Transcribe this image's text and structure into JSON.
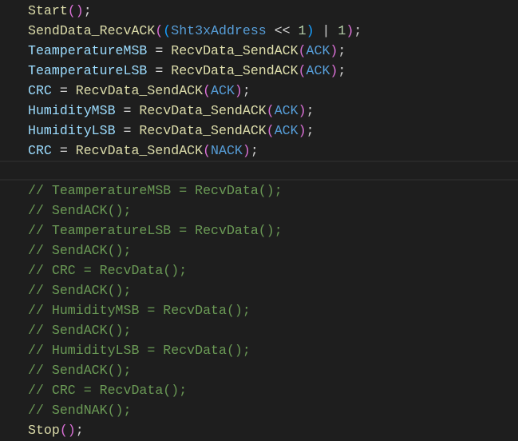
{
  "editor": {
    "current_line_index": 8,
    "colors": {
      "background": "#1e1e1e",
      "function": "#dcdcaa",
      "variable": "#9cdcfe",
      "macro": "#569cd6",
      "number": "#b5cea8",
      "paren1": "#da70d6",
      "paren2": "#179fff",
      "comment": "#6a9955"
    },
    "lines": [
      [
        [
          "Start",
          "fn"
        ],
        [
          "()",
          "p1"
        ],
        [
          ";",
          "op"
        ]
      ],
      [
        [
          "SendData_RecvACK",
          "fn"
        ],
        [
          "(",
          "p1"
        ],
        [
          "(",
          "p2"
        ],
        [
          "Sht3xAddress",
          "mac"
        ],
        [
          " << ",
          "op"
        ],
        [
          "1",
          "num"
        ],
        [
          ")",
          "p2"
        ],
        [
          " | ",
          "op"
        ],
        [
          "1",
          "num"
        ],
        [
          ")",
          "p1"
        ],
        [
          ";",
          "op"
        ]
      ],
      [
        [
          "TeamperatureMSB",
          "var"
        ],
        [
          " = ",
          "op"
        ],
        [
          "RecvData_SendACK",
          "fn"
        ],
        [
          "(",
          "p1"
        ],
        [
          "ACK",
          "mac"
        ],
        [
          ")",
          "p1"
        ],
        [
          ";",
          "op"
        ]
      ],
      [
        [
          "TeamperatureLSB",
          "var"
        ],
        [
          " = ",
          "op"
        ],
        [
          "RecvData_SendACK",
          "fn"
        ],
        [
          "(",
          "p1"
        ],
        [
          "ACK",
          "mac"
        ],
        [
          ")",
          "p1"
        ],
        [
          ";",
          "op"
        ]
      ],
      [
        [
          "CRC",
          "var"
        ],
        [
          " = ",
          "op"
        ],
        [
          "RecvData_SendACK",
          "fn"
        ],
        [
          "(",
          "p1"
        ],
        [
          "ACK",
          "mac"
        ],
        [
          ")",
          "p1"
        ],
        [
          ";",
          "op"
        ]
      ],
      [
        [
          "HumidityMSB",
          "var"
        ],
        [
          " = ",
          "op"
        ],
        [
          "RecvData_SendACK",
          "fn"
        ],
        [
          "(",
          "p1"
        ],
        [
          "ACK",
          "mac"
        ],
        [
          ")",
          "p1"
        ],
        [
          ";",
          "op"
        ]
      ],
      [
        [
          "HumidityLSB",
          "var"
        ],
        [
          " = ",
          "op"
        ],
        [
          "RecvData_SendACK",
          "fn"
        ],
        [
          "(",
          "p1"
        ],
        [
          "ACK",
          "mac"
        ],
        [
          ")",
          "p1"
        ],
        [
          ";",
          "op"
        ]
      ],
      [
        [
          "CRC",
          "var"
        ],
        [
          " = ",
          "op"
        ],
        [
          "RecvData_SendACK",
          "fn"
        ],
        [
          "(",
          "p1"
        ],
        [
          "NACK",
          "mac"
        ],
        [
          ")",
          "p1"
        ],
        [
          ";",
          "op"
        ]
      ],
      [],
      [
        [
          "// TeamperatureMSB = RecvData();",
          "cm"
        ]
      ],
      [
        [
          "// SendACK();",
          "cm"
        ]
      ],
      [
        [
          "// TeamperatureLSB = RecvData();",
          "cm"
        ]
      ],
      [
        [
          "// SendACK();",
          "cm"
        ]
      ],
      [
        [
          "// CRC = RecvData();",
          "cm"
        ]
      ],
      [
        [
          "// SendACK();",
          "cm"
        ]
      ],
      [
        [
          "// HumidityMSB = RecvData();",
          "cm"
        ]
      ],
      [
        [
          "// SendACK();",
          "cm"
        ]
      ],
      [
        [
          "// HumidityLSB = RecvData();",
          "cm"
        ]
      ],
      [
        [
          "// SendACK();",
          "cm"
        ]
      ],
      [
        [
          "// CRC = RecvData();",
          "cm"
        ]
      ],
      [
        [
          "// SendNAK();",
          "cm"
        ]
      ],
      [
        [
          "Stop",
          "fn"
        ],
        [
          "()",
          "p1"
        ],
        [
          ";",
          "op"
        ]
      ]
    ]
  }
}
